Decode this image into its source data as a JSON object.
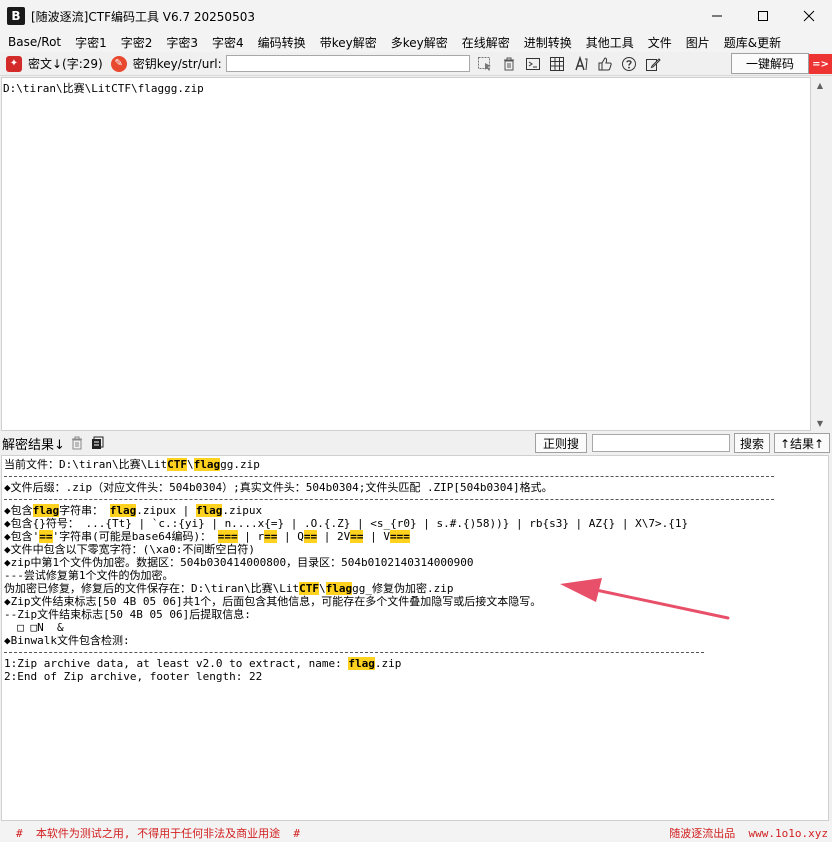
{
  "window": {
    "title": "[随波逐流]CTF编码工具 V6.7  20250503",
    "app_icon_glyph": "B",
    "minimize_glyph": "—",
    "maximize_glyph": "☐",
    "close_glyph": "✕"
  },
  "menu": [
    "Base/Rot",
    "字密1",
    "字密2",
    "字密3",
    "字密4",
    "编码转换",
    "带key解密",
    "多key解密",
    "在线解密",
    "进制转换",
    "其他工具",
    "文件",
    "图片",
    "题库&更新"
  ],
  "toolbar": {
    "cipher_label": "密文↓(字:29)",
    "key_label": "密钥key/str/url:",
    "key_value": "",
    "decode_button": "一键解码",
    "go_arrow": "=>",
    "tools": [
      "cursor-icon",
      "trash-icon",
      "terminal-icon",
      "table-icon",
      "font-icon",
      "thumbs-up-icon",
      "question-icon",
      "edit-icon"
    ]
  },
  "input": {
    "text": "D:\\tiran\\比赛\\LitCTF\\flaggg.zip"
  },
  "result_bar": {
    "label": "解密结果↓",
    "regex_button": "正则搜",
    "search_value": "",
    "search_button": "搜索",
    "result_toggle": "↑结果↑"
  },
  "result": {
    "lines": [
      {
        "t": "text",
        "parts": [
          [
            "当前文件：D:\\tiran\\比赛\\Lit",
            0
          ],
          [
            "CTF",
            1
          ],
          [
            "\\",
            0
          ],
          [
            "flag",
            1
          ],
          [
            "gg.zip",
            0
          ]
        ]
      },
      {
        "t": "sep-long"
      },
      {
        "t": "text",
        "parts": [
          [
            "◆文件后缀：.zip（对应文件头：504b0304）;真实文件头：504b0304;文件头匹配 .ZIP[504b0304]格式。",
            0
          ]
        ]
      },
      {
        "t": "sep-long"
      },
      {
        "t": "text",
        "parts": [
          [
            "◆包含",
            0
          ],
          [
            "flag",
            1
          ],
          [
            "字符串： ",
            0
          ],
          [
            "flag",
            1
          ],
          [
            ".zipux | ",
            0
          ],
          [
            "flag",
            1
          ],
          [
            ".zipux",
            0
          ]
        ]
      },
      {
        "t": "text",
        "parts": [
          [
            "◆包含{}符号： ...{Tt} | `c.:{yi} | n....x{=} | .O.{.Z} | <s_{r0} | s.#.{)58))} | rb{s3} | AZ{} | X\\7>.{1}",
            0
          ]
        ]
      },
      {
        "t": "text",
        "parts": [
          [
            "◆包含'",
            0
          ],
          [
            "==",
            1
          ],
          [
            "'字符串(可能是base64编码)： ",
            0
          ],
          [
            "===",
            1
          ],
          [
            " | r",
            0
          ],
          [
            "==",
            1
          ],
          [
            " | Q",
            0
          ],
          [
            "==",
            1
          ],
          [
            " | 2V",
            0
          ],
          [
            "==",
            1
          ],
          [
            " | V",
            0
          ],
          [
            "===",
            1
          ]
        ]
      },
      {
        "t": "text",
        "parts": [
          [
            "◆文件中包含以下零宽字符：(\\xa0:不间断空白符)",
            0
          ]
        ]
      },
      {
        "t": "text",
        "parts": [
          [
            "◆zip中第1个文件伪加密。数据区：504b030414000800，目录区：504b0102140314000900",
            0
          ]
        ]
      },
      {
        "t": "text",
        "parts": [
          [
            "---尝试修复第1个文件的伪加密。",
            0
          ]
        ]
      },
      {
        "t": "text",
        "parts": [
          [
            "伪加密已修复，修复后的文件保存在：D:\\tiran\\比赛\\Lit",
            0
          ],
          [
            "CTF",
            1
          ],
          [
            "\\",
            0
          ],
          [
            "flag",
            1
          ],
          [
            "gg_修复伪加密.zip",
            0
          ]
        ]
      },
      {
        "t": "text",
        "parts": [
          [
            "◆Zip文件结束标志[50 4B 05 06]共1个，后面包含其他信息，可能存在多个文件叠加隐写或后接文本隐写。",
            0
          ]
        ]
      },
      {
        "t": "text",
        "parts": [
          [
            "--Zip文件结束标志[50 4B 05 06]后提取信息:",
            0
          ]
        ]
      },
      {
        "t": "text",
        "parts": [
          [
            "  □ □N  &",
            0
          ]
        ]
      },
      {
        "t": "text",
        "parts": [
          [
            "◆Binwalk文件包含检测:",
            0
          ]
        ]
      },
      {
        "t": "sep-short"
      },
      {
        "t": "text",
        "parts": [
          [
            "1:Zip archive data, at least v2.0 to extract, name: ",
            0
          ],
          [
            "flag",
            1
          ],
          [
            ".zip",
            0
          ]
        ]
      },
      {
        "t": "text",
        "parts": [
          [
            "2:End of Zip archive, footer length: 22",
            0
          ]
        ]
      }
    ]
  },
  "footer": {
    "left": "#  本软件为测试之用, 不得用于任何非法及商业用途  #",
    "right": "随波逐流出品  www.1o1o.xyz"
  },
  "colors": {
    "highlight": "#ffd21f",
    "footer_text": "#d22020",
    "annotation_arrow": "#e8506a"
  }
}
